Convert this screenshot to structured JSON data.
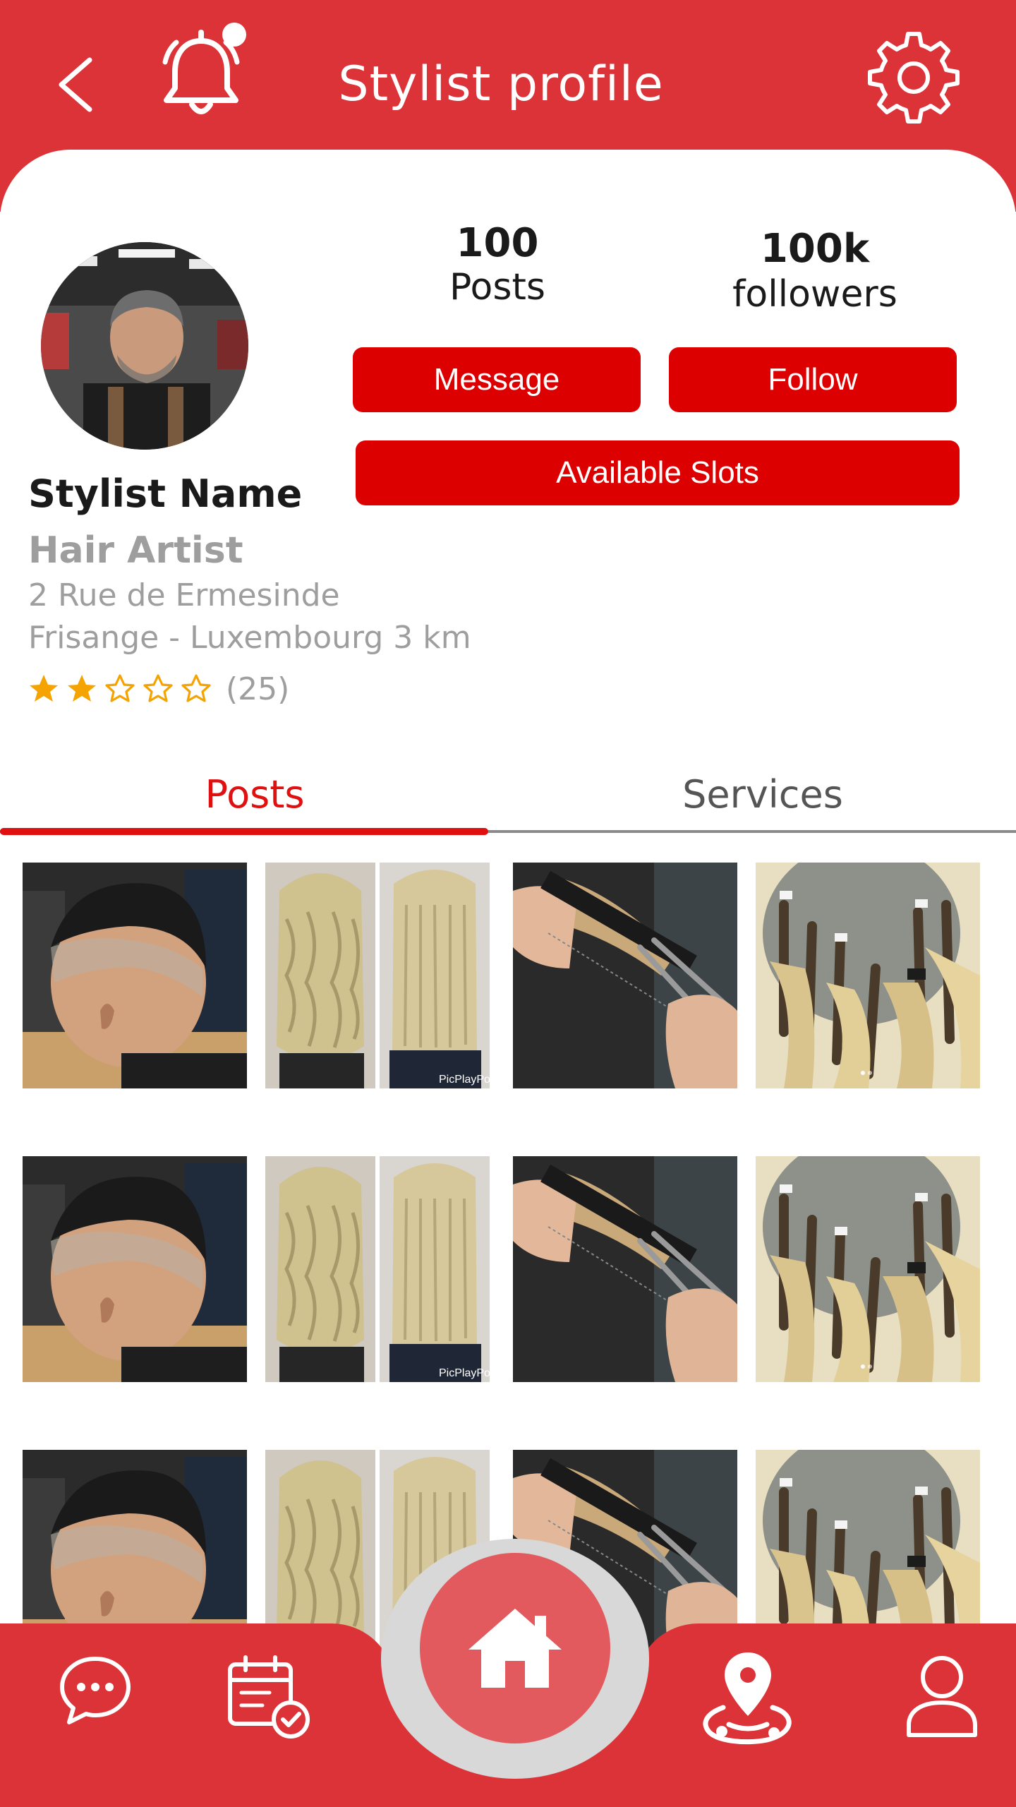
{
  "header": {
    "title": "Stylist profile",
    "icons": [
      "back-arrow-icon",
      "bell-icon",
      "gear-icon"
    ]
  },
  "profile": {
    "posts_count": "100",
    "posts_label": "Posts",
    "followers_count": "100k",
    "followers_label": "followers",
    "message_label": "Message",
    "follow_label": "Follow",
    "slots_label": "Available Slots",
    "name": "Stylist Name",
    "role": "Hair Artist",
    "address_line1": "2 Rue de Ermesinde",
    "address_line2": "Frisange - Luxembourg 3 km",
    "rating": 2,
    "rating_max": 5,
    "rating_count": "(25)"
  },
  "tabs": {
    "posts": "Posts",
    "services": "Services",
    "active": "posts"
  },
  "posts_grid": {
    "thumbnails": [
      "fade-haircut",
      "before-after-blonde-waves",
      "scissors-comb-cutting",
      "hair-extensions-mannequin"
    ],
    "watermark": "PicPlayPost"
  },
  "bottom_nav": {
    "items": [
      "chat-icon",
      "calendar-check-icon",
      "home-icon",
      "location-pin-icon",
      "user-icon"
    ]
  },
  "colors": {
    "primary": "#dc3338",
    "button_red": "#dc0000",
    "active_tab": "#e01010",
    "star": "#f5a300",
    "muted_text": "#9e9e9e"
  }
}
